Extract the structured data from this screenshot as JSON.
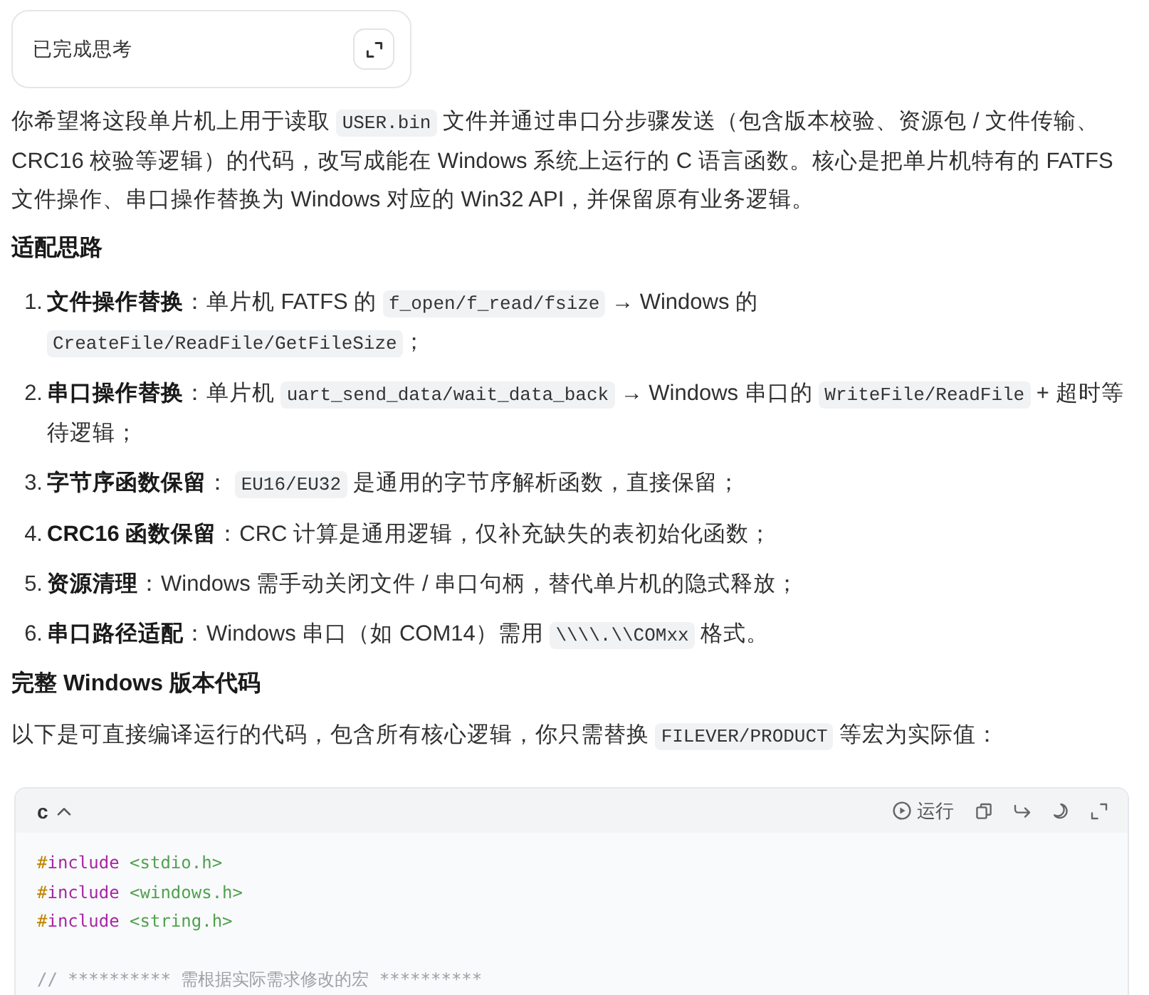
{
  "thinking_card": {
    "label": "已完成思考"
  },
  "blocks": [
    {
      "kind": "paragraph",
      "segments": [
        {
          "kind": "text",
          "text": "你希望将这段单片机上用于读取 "
        },
        {
          "kind": "code",
          "text": "USER.bin"
        },
        {
          "kind": "text",
          "text": " 文件并通过串口分步骤发送（包含版本校验、资源包 / 文件传输、CRC16 校验等逻辑）的代码，改写成能在 Windows 系统上运行的 C 语言函数。核心是把单片机特有的 FATFS 文件操作、串口操作替换为 Windows 对应的 Win32 API，并保留原有业务逻辑。"
        }
      ]
    },
    {
      "kind": "heading",
      "text": "适配思路"
    },
    {
      "kind": "list",
      "items": [
        {
          "number": "1.",
          "segments": [
            {
              "kind": "bold",
              "text": "文件操作替换"
            },
            {
              "kind": "text",
              "text": "：单片机 FATFS 的 "
            },
            {
              "kind": "code",
              "text": "f_open/f_read/fsize"
            },
            {
              "kind": "text",
              "text": " → Windows 的 "
            },
            {
              "kind": "code",
              "text": "CreateFile/ReadFile/GetFileSize"
            },
            {
              "kind": "text",
              "text": "；"
            }
          ]
        },
        {
          "number": "2.",
          "segments": [
            {
              "kind": "bold",
              "text": "串口操作替换"
            },
            {
              "kind": "text",
              "text": "：单片机 "
            },
            {
              "kind": "code",
              "text": "uart_send_data/wait_data_back"
            },
            {
              "kind": "text",
              "text": " → Windows 串口的 "
            },
            {
              "kind": "code",
              "text": "WriteFile/ReadFile"
            },
            {
              "kind": "text",
              "text": " + 超时等待逻辑；"
            }
          ]
        },
        {
          "number": "3.",
          "segments": [
            {
              "kind": "bold",
              "text": "字节序函数保留"
            },
            {
              "kind": "text",
              "text": "： "
            },
            {
              "kind": "code",
              "text": "EU16/EU32"
            },
            {
              "kind": "text",
              "text": " 是通用的字节序解析函数，直接保留；"
            }
          ]
        },
        {
          "number": "4.",
          "segments": [
            {
              "kind": "bold",
              "text": "CRC16 函数保留"
            },
            {
              "kind": "text",
              "text": "：CRC 计算是通用逻辑，仅补充缺失的表初始化函数；"
            }
          ]
        },
        {
          "number": "5.",
          "segments": [
            {
              "kind": "bold",
              "text": "资源清理"
            },
            {
              "kind": "text",
              "text": "：Windows 需手动关闭文件 / 串口句柄，替代单片机的隐式释放；"
            }
          ]
        },
        {
          "number": "6.",
          "segments": [
            {
              "kind": "bold",
              "text": "串口路径适配"
            },
            {
              "kind": "text",
              "text": "：Windows 串口（如 COM14）需用 "
            },
            {
              "kind": "code",
              "text": "\\\\\\\\.\\\\COMxx"
            },
            {
              "kind": "text",
              "text": " 格式。"
            }
          ]
        }
      ]
    },
    {
      "kind": "heading",
      "text": "完整 Windows 版本代码"
    },
    {
      "kind": "paragraph",
      "segments": [
        {
          "kind": "text",
          "text": "以下是可直接编译运行的代码，包含所有核心逻辑，你只需替换 "
        },
        {
          "kind": "code",
          "text": "FILEVER/PRODUCT"
        },
        {
          "kind": "text",
          "text": " 等宏为实际值："
        }
      ]
    },
    {
      "kind": "code_block",
      "language": "c",
      "run_label": "运行",
      "line_groups": [
        {
          "lines": [
            {
              "tokens": [
                {
                  "kind": "hash",
                  "text": "#"
                },
                {
                  "kind": "keyword",
                  "text": "include"
                },
                {
                  "kind": "string",
                  "text": " <stdio.h>"
                }
              ]
            },
            {
              "tokens": [
                {
                  "kind": "hash",
                  "text": "#"
                },
                {
                  "kind": "keyword",
                  "text": "include"
                },
                {
                  "kind": "string",
                  "text": " <windows.h>"
                }
              ]
            },
            {
              "tokens": [
                {
                  "kind": "hash",
                  "text": "#"
                },
                {
                  "kind": "keyword",
                  "text": "include"
                },
                {
                  "kind": "string",
                  "text": " <string.h>"
                }
              ]
            }
          ]
        },
        {
          "lines": [
            {
              "tokens": [
                {
                  "kind": "comment",
                  "text": "// ********** 需根据实际需求修改的宏 **********"
                }
              ]
            }
          ]
        }
      ]
    }
  ]
}
